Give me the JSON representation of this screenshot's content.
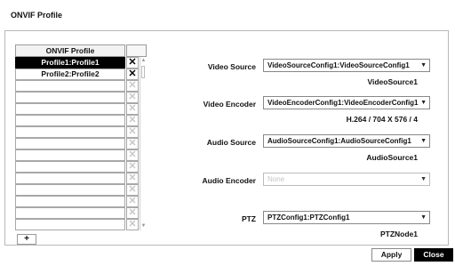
{
  "window": {
    "title": "ONVIF Profile"
  },
  "profiles": {
    "header": "ONVIF Profile",
    "rows": [
      {
        "name": "Profile1:Profile1",
        "selected": true,
        "delete_enabled": true
      },
      {
        "name": "Profile2:Profile2",
        "selected": false,
        "delete_enabled": true
      },
      {
        "name": "",
        "selected": false,
        "delete_enabled": false
      },
      {
        "name": "",
        "selected": false,
        "delete_enabled": false
      },
      {
        "name": "",
        "selected": false,
        "delete_enabled": false
      },
      {
        "name": "",
        "selected": false,
        "delete_enabled": false
      },
      {
        "name": "",
        "selected": false,
        "delete_enabled": false
      },
      {
        "name": "",
        "selected": false,
        "delete_enabled": false
      },
      {
        "name": "",
        "selected": false,
        "delete_enabled": false
      },
      {
        "name": "",
        "selected": false,
        "delete_enabled": false
      },
      {
        "name": "",
        "selected": false,
        "delete_enabled": false
      },
      {
        "name": "",
        "selected": false,
        "delete_enabled": false
      },
      {
        "name": "",
        "selected": false,
        "delete_enabled": false
      },
      {
        "name": "",
        "selected": false,
        "delete_enabled": false
      },
      {
        "name": "",
        "selected": false,
        "delete_enabled": false
      }
    ],
    "delete_glyph": "✕",
    "add_label": "+"
  },
  "fields": {
    "video_source": {
      "label": "Video Source",
      "value": "VideoSourceConfig1:VideoSourceConfig1",
      "sub": "VideoSource1"
    },
    "video_encoder": {
      "label": "Video Encoder",
      "value": "VideoEncoderConfig1:VideoEncoderConfig1",
      "sub": "H.264 / 704 X 576 / 4"
    },
    "audio_source": {
      "label": "Audio Source",
      "value": "AudioSourceConfig1:AudioSourceConfig1",
      "sub": "AudioSource1"
    },
    "audio_encoder": {
      "label": "Audio Encoder",
      "value": "None",
      "sub": ""
    },
    "ptz": {
      "label": "PTZ",
      "value": "PTZConfig1:PTZConfig1",
      "sub": "PTZNode1"
    }
  },
  "dropdown_arrow": "▼",
  "buttons": {
    "apply": "Apply",
    "close": "Close"
  },
  "colors": {
    "selected_bg": "#000000",
    "selected_text": "#ffffff",
    "disabled_text": "#c4c4c4"
  }
}
